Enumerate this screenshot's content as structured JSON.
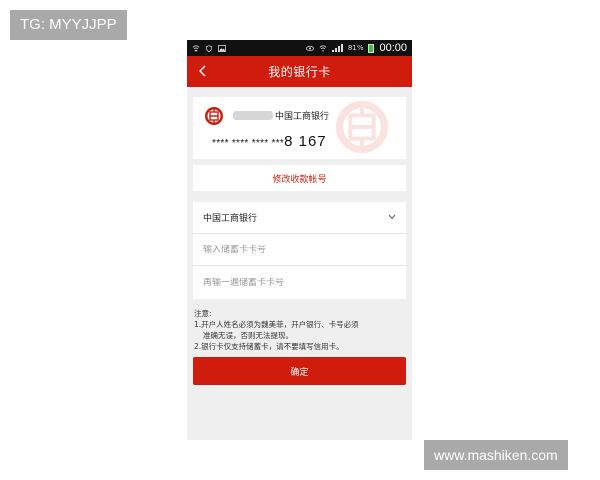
{
  "watermarks": {
    "top_left": "TG: MYYJJPP",
    "bottom_right": "www.mashiken.com"
  },
  "status_bar": {
    "battery_text": "81%",
    "time": "00:00"
  },
  "header": {
    "title": "我的银行卡",
    "back_icon": "chevron-left-icon"
  },
  "card": {
    "bank_name": "中国工商银行",
    "number_masked": "**** **** **** ***",
    "number_tail": "8 167",
    "logo_icon": "icbc-logo-icon"
  },
  "modify_button": {
    "label": "修改收款帐号"
  },
  "form": {
    "bank_select": {
      "value": "中国工商银行"
    },
    "card_input": {
      "placeholder": "输入储蓄卡卡号"
    },
    "card_confirm_input": {
      "placeholder": "再输一遍储蓄卡卡号"
    }
  },
  "notes": {
    "title": "注意:",
    "line1": "1.开户人姓名必须为魏美菲，开户银行、卡号必须",
    "line1b": "准确无误，否则无法提现。",
    "line2": "2.银行卡仅支持储蓄卡，请不要填写信用卡。"
  },
  "confirm_button": {
    "label": "确定"
  },
  "colors": {
    "accent": "#cf1c0c",
    "background": "#efefef"
  }
}
